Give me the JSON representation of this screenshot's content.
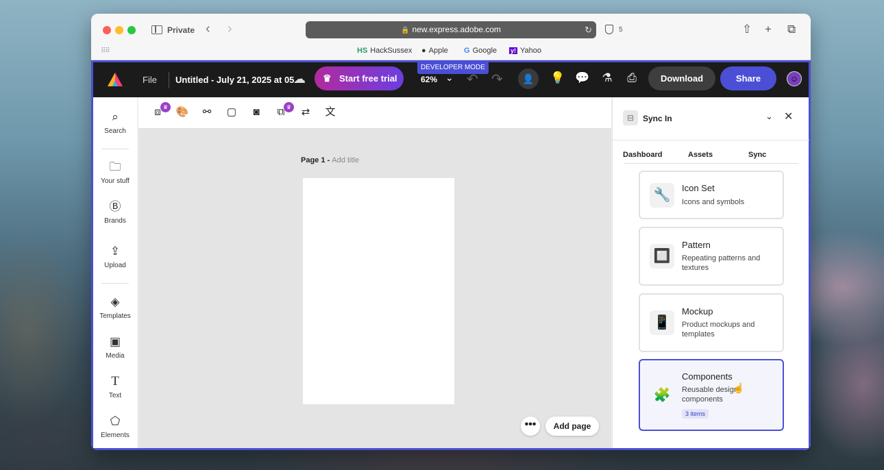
{
  "browser": {
    "private_label": "Private",
    "url": "new.express.adobe.com",
    "shield_count": "5",
    "bookmarks": [
      {
        "icon": "HS",
        "label": "HackSussex"
      },
      {
        "icon": "",
        "label": "Apple"
      },
      {
        "icon": "G",
        "label": "Google"
      },
      {
        "icon": "y!",
        "label": "Yahoo"
      }
    ]
  },
  "topbar": {
    "file_label": "File",
    "doc_title": "Untitled - July 21, 2025 at 05...",
    "trial_label": "Start free trial",
    "dev_mode": "DEVELOPER MODE",
    "zoom": "62%",
    "download_label": "Download",
    "share_label": "Share"
  },
  "left_rail": {
    "items": [
      {
        "icon": "search-icon",
        "label": "Search"
      },
      {
        "icon": "folder-icon",
        "label": "Your stuff"
      },
      {
        "icon": "brand-icon",
        "label": "Brands"
      },
      {
        "icon": "upload-icon",
        "label": "Upload"
      },
      {
        "icon": "templates-icon",
        "label": "Templates"
      },
      {
        "icon": "media-icon",
        "label": "Media"
      },
      {
        "icon": "text-icon",
        "label": "Text"
      },
      {
        "icon": "elements-icon",
        "label": "Elements"
      }
    ]
  },
  "canvas": {
    "page_label": "Page 1 - ",
    "page_title_placeholder": "Add title",
    "more_label": "•••",
    "add_page_label": "Add page"
  },
  "panel": {
    "title": "Sync In",
    "tabs": [
      "Dashboard",
      "Assets",
      "Sync"
    ],
    "cards": [
      {
        "icon": "🔧",
        "title": "Icon Set",
        "desc": "Icons and symbols",
        "count": "",
        "selected": false
      },
      {
        "icon": "🔲",
        "title": "Pattern",
        "desc": "Repeating patterns and textures",
        "count": "",
        "selected": false
      },
      {
        "icon": "📱",
        "title": "Mockup",
        "desc": "Product mockups and templates",
        "count": "",
        "selected": false
      },
      {
        "icon": "🧩",
        "title": "Components",
        "desc": "Reusable design components",
        "count": "3 items",
        "selected": true
      }
    ]
  },
  "colors": {
    "accent": "#4b4fd6",
    "trial_gradient_start": "#b22a9f",
    "trial_gradient_end": "#6a3fe0"
  }
}
